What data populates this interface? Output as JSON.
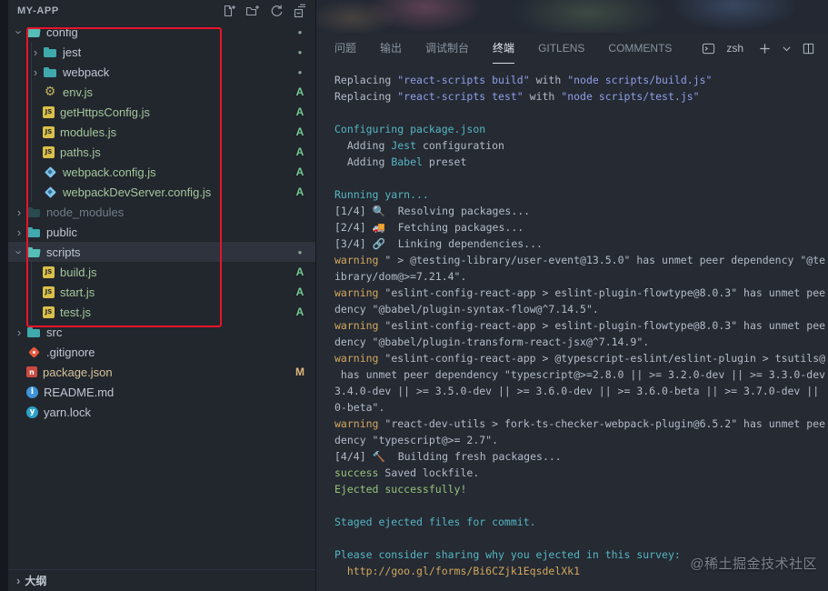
{
  "palette": {
    "sidebar_bg": "#22262d",
    "panel_bg": "#252a33",
    "terminal_fg": "#b4bcc8",
    "cyan": "#56b6c2",
    "string_blue": "#8f9fe8",
    "warning_yellow": "#d3a85e",
    "success_green": "#98c379",
    "git_added": "#73c991",
    "git_modified": "#dcb67a",
    "annotation_red": "#e9132a",
    "folder_teal": "#3fa9ad"
  },
  "explorer": {
    "title": "MY-APP",
    "action_icons": [
      "new-file-icon",
      "new-folder-icon",
      "refresh-icon",
      "collapse-all-icon"
    ],
    "outline_label": "大纲",
    "tree": [
      {
        "label": "config",
        "icon": "folder-open",
        "indent": 0,
        "chevron": "down",
        "badge": "dot"
      },
      {
        "label": "jest",
        "icon": "folder",
        "indent": 1,
        "chevron": "right",
        "badge": "dot"
      },
      {
        "label": "webpack",
        "icon": "folder",
        "indent": 1,
        "chevron": "right",
        "badge": "dot"
      },
      {
        "label": "env.js",
        "icon": "gear",
        "indent": 1,
        "badge": "A"
      },
      {
        "label": "getHttpsConfig.js",
        "icon": "js",
        "indent": 1,
        "badge": "A"
      },
      {
        "label": "modules.js",
        "icon": "js",
        "indent": 1,
        "badge": "A"
      },
      {
        "label": "paths.js",
        "icon": "js",
        "indent": 1,
        "badge": "A"
      },
      {
        "label": "webpack.config.js",
        "icon": "webpack",
        "indent": 1,
        "badge": "A"
      },
      {
        "label": "webpackDevServer.config.js",
        "icon": "webpack",
        "indent": 1,
        "badge": "A"
      },
      {
        "label": "node_modules",
        "icon": "folder-dim",
        "indent": 0,
        "chevron": "right",
        "badge": "",
        "dim": true
      },
      {
        "label": "public",
        "icon": "folder",
        "indent": 0,
        "chevron": "right",
        "badge": ""
      },
      {
        "label": "scripts",
        "icon": "folder-open",
        "indent": 0,
        "chevron": "down",
        "badge": "dot",
        "selected": true
      },
      {
        "label": "build.js",
        "icon": "js",
        "indent": 1,
        "badge": "A"
      },
      {
        "label": "start.js",
        "icon": "js",
        "indent": 1,
        "badge": "A"
      },
      {
        "label": "test.js",
        "icon": "js",
        "indent": 1,
        "badge": "A"
      },
      {
        "label": "src",
        "icon": "folder",
        "indent": 0,
        "chevron": "right",
        "badge": ""
      },
      {
        "label": ".gitignore",
        "icon": "git",
        "indent": 0,
        "badge": ""
      },
      {
        "label": "package.json",
        "icon": "npm",
        "indent": 0,
        "badge": "M"
      },
      {
        "label": "README.md",
        "icon": "info",
        "indent": 0,
        "badge": ""
      },
      {
        "label": "yarn.lock",
        "icon": "yarn",
        "indent": 0,
        "badge": ""
      }
    ]
  },
  "panel": {
    "tabs": [
      {
        "id": "problems",
        "label": "问题"
      },
      {
        "id": "output",
        "label": "输出"
      },
      {
        "id": "debug-console",
        "label": "调试制台"
      },
      {
        "id": "terminal",
        "label": "终端",
        "active": true
      },
      {
        "id": "gitlens",
        "label": "GITLENS"
      },
      {
        "id": "comments",
        "label": "COMMENTS"
      }
    ],
    "shell_label": "zsh",
    "action_icons": [
      "terminal-icon",
      "plus-icon",
      "chevron-down-icon",
      "split-terminal-icon"
    ],
    "terminal_lines": [
      [
        {
          "t": "Replacing ",
          "c": "fg"
        },
        {
          "t": "\"react-scripts build\"",
          "c": "str"
        },
        {
          "t": " with ",
          "c": "fg"
        },
        {
          "t": "\"node scripts/build.js\"",
          "c": "str"
        }
      ],
      [
        {
          "t": "Replacing ",
          "c": "fg"
        },
        {
          "t": "\"react-scripts test\"",
          "c": "str"
        },
        {
          "t": " with ",
          "c": "fg"
        },
        {
          "t": "\"node scripts/test.js\"",
          "c": "str"
        }
      ],
      [],
      [
        {
          "t": "Configuring package.json",
          "c": "cyan"
        }
      ],
      [
        {
          "t": "  Adding ",
          "c": "fg"
        },
        {
          "t": "Jest",
          "c": "cyan"
        },
        {
          "t": " configuration",
          "c": "fg"
        }
      ],
      [
        {
          "t": "  Adding ",
          "c": "fg"
        },
        {
          "t": "Babel",
          "c": "cyan"
        },
        {
          "t": " preset",
          "c": "fg"
        }
      ],
      [],
      [
        {
          "t": "Running yarn...",
          "c": "cyan"
        }
      ],
      [
        {
          "t": "[1/4] 🔍  Resolving packages...",
          "c": "fg"
        }
      ],
      [
        {
          "t": "[2/4] 🚚  Fetching packages...",
          "c": "fg"
        }
      ],
      [
        {
          "t": "[3/4] 🔗  Linking dependencies...",
          "c": "fg"
        }
      ],
      [
        {
          "t": "warning",
          "c": "yellow"
        },
        {
          "t": " \" > @testing-library/user-event@13.5.0\" has unmet peer dependency \"@te",
          "c": "fg"
        }
      ],
      [
        {
          "t": "ibrary/dom@>=7.21.4\".",
          "c": "fg"
        }
      ],
      [
        {
          "t": "warning",
          "c": "yellow"
        },
        {
          "t": " \"eslint-config-react-app > eslint-plugin-flowtype@8.0.3\" has unmet pee",
          "c": "fg"
        }
      ],
      [
        {
          "t": "dency \"@babel/plugin-syntax-flow@^7.14.5\".",
          "c": "fg"
        }
      ],
      [
        {
          "t": "warning",
          "c": "yellow"
        },
        {
          "t": " \"eslint-config-react-app > eslint-plugin-flowtype@8.0.3\" has unmet pee",
          "c": "fg"
        }
      ],
      [
        {
          "t": "dency \"@babel/plugin-transform-react-jsx@^7.14.9\".",
          "c": "fg"
        }
      ],
      [
        {
          "t": "warning",
          "c": "yellow"
        },
        {
          "t": " \"eslint-config-react-app > @typescript-eslint/eslint-plugin > tsutils@",
          "c": "fg"
        }
      ],
      [
        {
          "t": " has unmet peer dependency \"typescript@>=2.8.0 || >= 3.2.0-dev || >= 3.3.0-dev",
          "c": "fg"
        }
      ],
      [
        {
          "t": "3.4.0-dev || >= 3.5.0-dev || >= 3.6.0-dev || >= 3.6.0-beta || >= 3.7.0-dev ||",
          "c": "fg"
        }
      ],
      [
        {
          "t": "0-beta\".",
          "c": "fg"
        }
      ],
      [
        {
          "t": "warning",
          "c": "yellow"
        },
        {
          "t": " \"react-dev-utils > fork-ts-checker-webpack-plugin@6.5.2\" has unmet pee",
          "c": "fg"
        }
      ],
      [
        {
          "t": "dency \"typescript@>= 2.7\".",
          "c": "fg"
        }
      ],
      [
        {
          "t": "[4/4] 🔨  Building fresh packages...",
          "c": "fg"
        }
      ],
      [
        {
          "t": "success",
          "c": "green"
        },
        {
          "t": " Saved lockfile.",
          "c": "fg"
        }
      ],
      [
        {
          "t": "Ejected successfully!",
          "c": "green"
        }
      ],
      [],
      [
        {
          "t": "Staged ejected files for commit.",
          "c": "cyan"
        }
      ],
      [],
      [
        {
          "t": "Please consider sharing why you ejected in this survey:",
          "c": "cyan"
        }
      ],
      [
        {
          "t": "  ",
          "c": "fg"
        },
        {
          "t": "http://goo.gl/forms/Bi6CZjk1EqsdelXk1",
          "c": "yellow",
          "name": "survey-link",
          "link": true
        }
      ]
    ]
  },
  "watermark": {
    "text": "@稀土掘金技术社区"
  },
  "annotation": {
    "shape": "rectangle",
    "color": "#e9132a"
  }
}
